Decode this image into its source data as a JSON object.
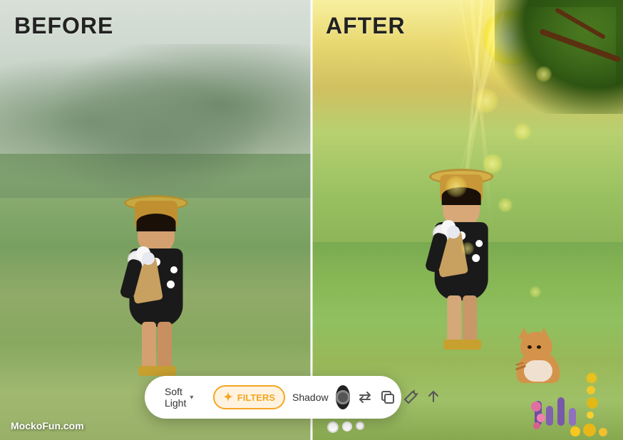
{
  "before_label": "BEFORE",
  "after_label": "AFTER",
  "watermark": "MockoFun.com",
  "toolbar": {
    "blend_mode": "Soft Light",
    "blend_mode_chevron": "▾",
    "filters_label": "FILTERS",
    "filters_star": "✦",
    "shadow_label": "Shadow",
    "swap_icon": "⇄",
    "copy_icon": "❐",
    "wand_icon": "✦",
    "up_icon": "↑"
  }
}
